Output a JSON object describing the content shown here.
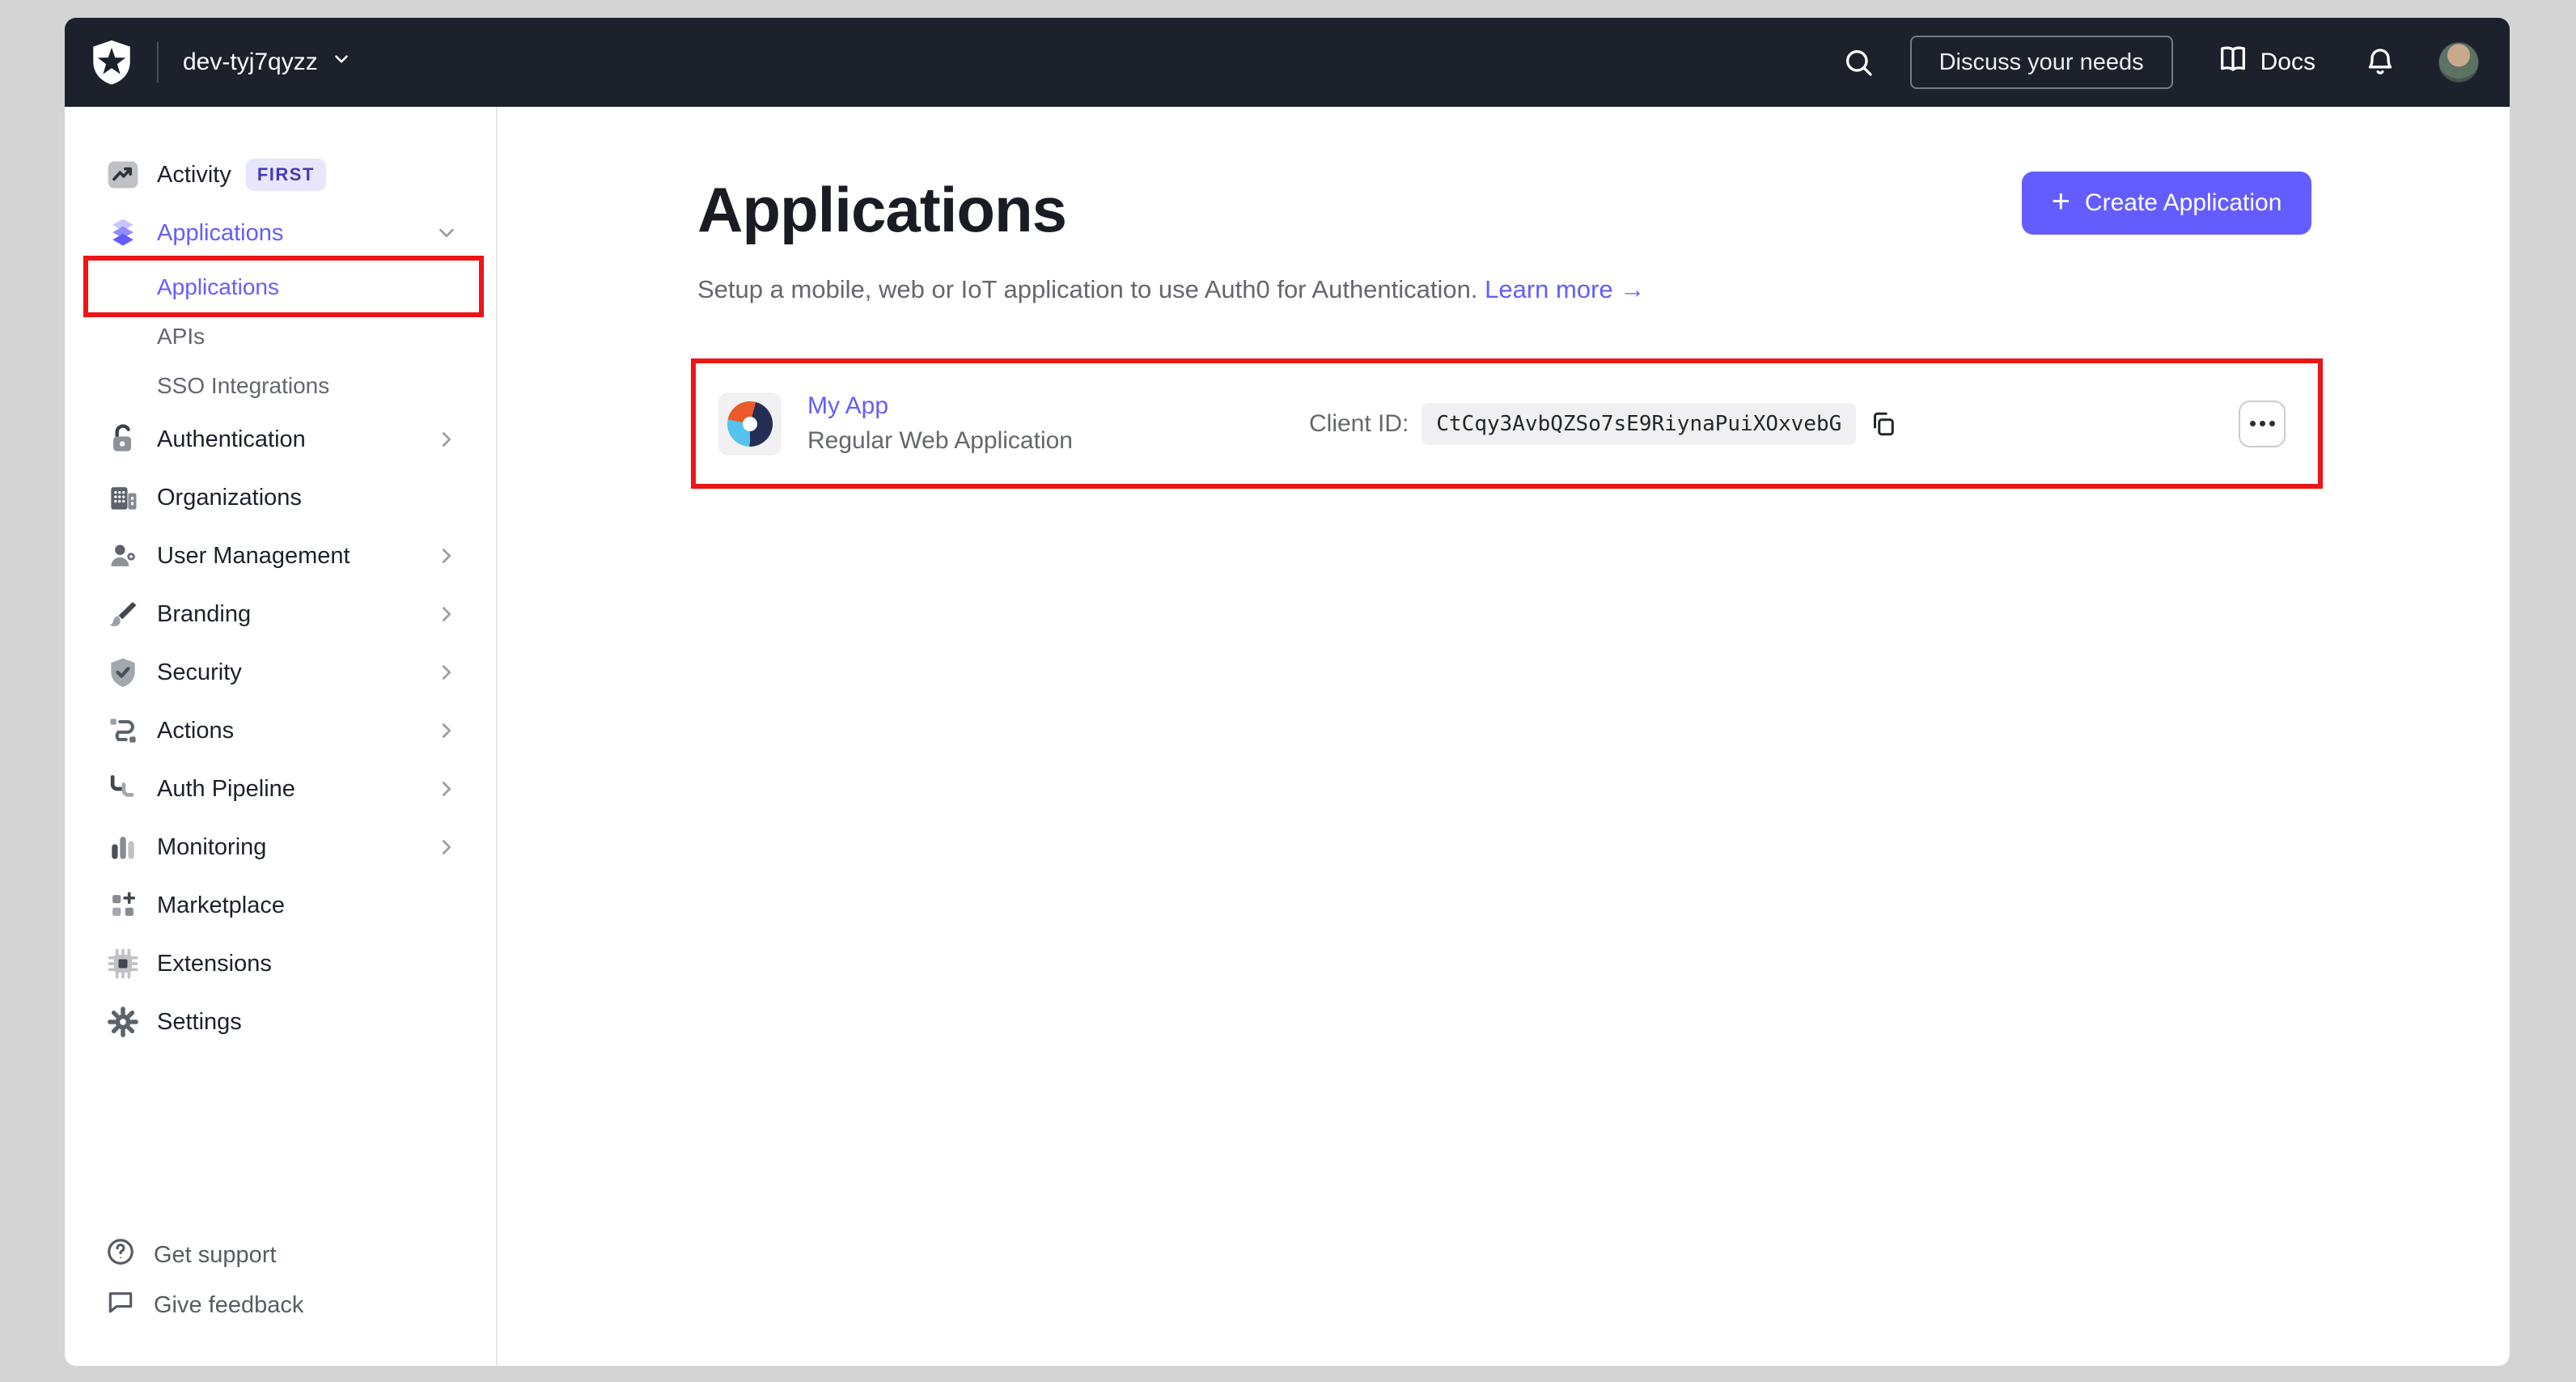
{
  "topbar": {
    "tenant": "dev-tyj7qyzz",
    "discuss_label": "Discuss your needs",
    "docs_label": "Docs"
  },
  "sidebar": {
    "items": [
      {
        "label": "Activity",
        "badge": "FIRST"
      },
      {
        "label": "Applications",
        "expanded": true,
        "active": true
      },
      {
        "label": "Authentication"
      },
      {
        "label": "Organizations"
      },
      {
        "label": "User Management"
      },
      {
        "label": "Branding"
      },
      {
        "label": "Security"
      },
      {
        "label": "Actions"
      },
      {
        "label": "Auth Pipeline"
      },
      {
        "label": "Monitoring"
      },
      {
        "label": "Marketplace"
      },
      {
        "label": "Extensions"
      },
      {
        "label": "Settings"
      }
    ],
    "sub_items": [
      {
        "label": "Applications",
        "active": true,
        "highlighted": true
      },
      {
        "label": "APIs"
      },
      {
        "label": "SSO Integrations"
      }
    ],
    "footer": [
      {
        "label": "Get support"
      },
      {
        "label": "Give feedback"
      }
    ]
  },
  "main": {
    "title": "Applications",
    "subtitle": "Setup a mobile, web or IoT application to use Auth0 for Authentication.",
    "learn_more_label": "Learn more",
    "learn_more_arrow": "→",
    "create_button_plus": "+",
    "create_button_label": "Create Application",
    "app_row": {
      "name": "My App",
      "type": "Regular Web Application",
      "client_id_label": "Client ID:",
      "client_id": "CtCqy3AvbQZSo7sE9RiynaPuiXOxvebG"
    }
  },
  "colors": {
    "accent": "#635dff",
    "topbar_bg": "#1c212b",
    "annotation_red": "#ed1515",
    "text_muted": "#65676e",
    "badge_bg": "#e8e6fc",
    "badge_text": "#453ab7",
    "logo_orange": "#eb5a2d",
    "logo_navy": "#242d54",
    "logo_cyan": "#55c3ee"
  }
}
